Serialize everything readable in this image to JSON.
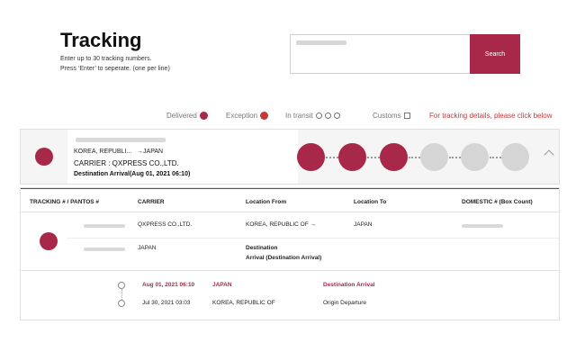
{
  "header": {
    "title": "Tracking",
    "help_line1": "Enter up to 30 tracking numbers.",
    "help_line2": "Press ‘Enter’ to seperate. (one per line)"
  },
  "search": {
    "button_label": "Search"
  },
  "legend": {
    "delivered": "Delivered",
    "exception": "Exception",
    "in_transit": "In transit",
    "customs": "Customs",
    "details_link": "For tracking details, please click below"
  },
  "summary": {
    "route_from": "KOREA, REPUBLI...",
    "route_to": "→JAPAN",
    "carrier": "CARRIER : QXPRESS CO.,LTD.",
    "destination": "Destination Arrival(Aug 01, 2021 06:10)"
  },
  "table": {
    "headers": {
      "tracking": "TRACKING # / PANTOS #",
      "carrier": "CARRIER",
      "location_from": "Location From",
      "location_to": "Location To",
      "domestic": "DOMESTIC # (Box Count)"
    },
    "row1": {
      "carrier": "QXPRESS CO.,LTD.",
      "location_from": "KOREA, REPUBLIC OF →",
      "location_to": "JAPAN"
    },
    "row2": {
      "carrier": "JAPAN",
      "status_line1": "Destination",
      "status_line2": "Arrival   (Destination Arrival)"
    }
  },
  "events": [
    {
      "date": "Aug 01, 2021 06:10",
      "location": "JAPAN",
      "status": "Destination Arrival"
    },
    {
      "date": "Jul 30, 2021 03:03",
      "location": "KOREA, REPUBLIC OF",
      "status": "Origin Departure"
    }
  ],
  "colors": {
    "brand": "#a8284a",
    "link": "#c23a3a",
    "inactive_step": "#d5d5d5"
  },
  "icons": {
    "delivered": "delivered-icon",
    "exception": "exception-icon",
    "in_transit": "transit-icon",
    "customs": "customs-icon",
    "steps": [
      "warehouse-icon",
      "plane-depart-icon",
      "plane-arrive-icon",
      "clipboard-icon",
      "truck-icon",
      "user-check-icon"
    ]
  }
}
